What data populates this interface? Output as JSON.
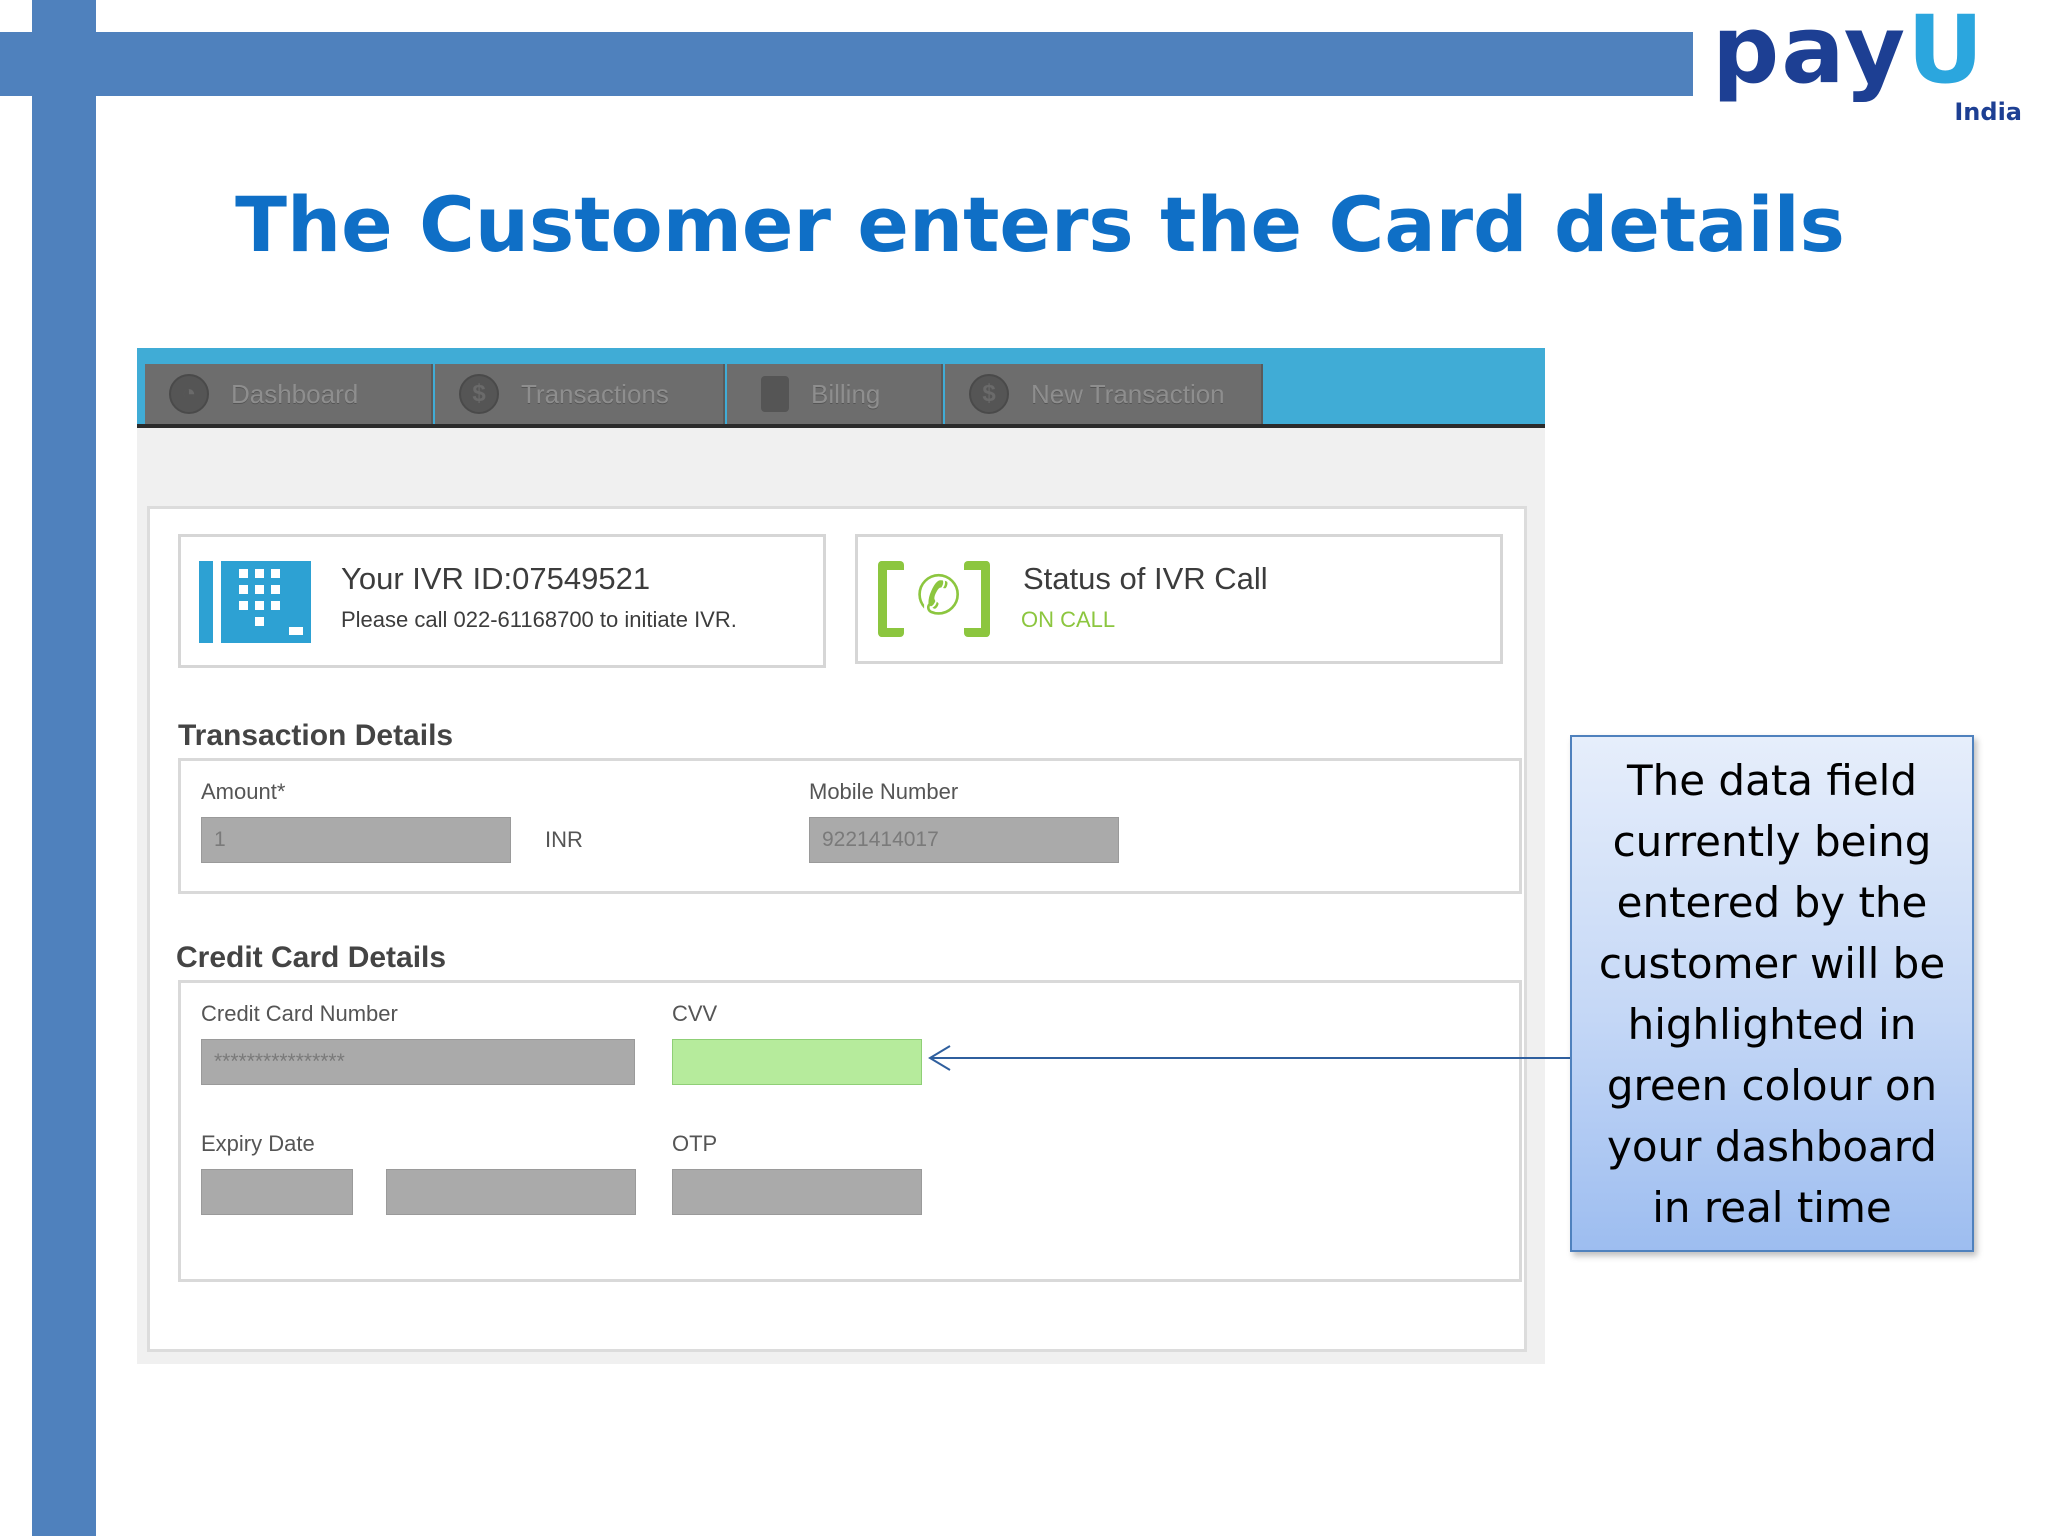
{
  "slide": {
    "title": "The Customer enters the Card details",
    "colors": {
      "bar": "#4f81bd",
      "title": "#0f6fc6"
    }
  },
  "logo": {
    "word_main": "pay",
    "word_accent": "U",
    "sub": "India"
  },
  "navbar": {
    "tabs": [
      {
        "label": "Dashboard",
        "icon": "dashboard-icon"
      },
      {
        "label": "Transactions",
        "icon": "dollar-icon"
      },
      {
        "label": "Billing",
        "icon": "document-icon"
      },
      {
        "label": "New Transaction",
        "icon": "new-transaction-icon"
      }
    ]
  },
  "ivr": {
    "title": "Your IVR ID:07549521",
    "subtitle": "Please call 022-61168700 to initiate IVR."
  },
  "status": {
    "title": "Status of IVR Call",
    "value": "ON CALL",
    "color": "#8cc63f"
  },
  "transaction": {
    "title": "Transaction Details",
    "amount_label": "Amount*",
    "amount_value": "1",
    "currency": "INR",
    "mobile_label": "Mobile Number",
    "mobile_value": "9221414017"
  },
  "credit_card": {
    "title": "Credit Card Details",
    "number_label": "Credit Card Number",
    "number_value": "****************",
    "cvv_label": "CVV",
    "cvv_value": "",
    "expiry_label": "Expiry Date",
    "otp_label": "OTP",
    "active_color": "#b6eb9c"
  },
  "callout": {
    "text": "The data field currently being entered by the customer will be highlighted in green colour on your dashboard in real time"
  }
}
